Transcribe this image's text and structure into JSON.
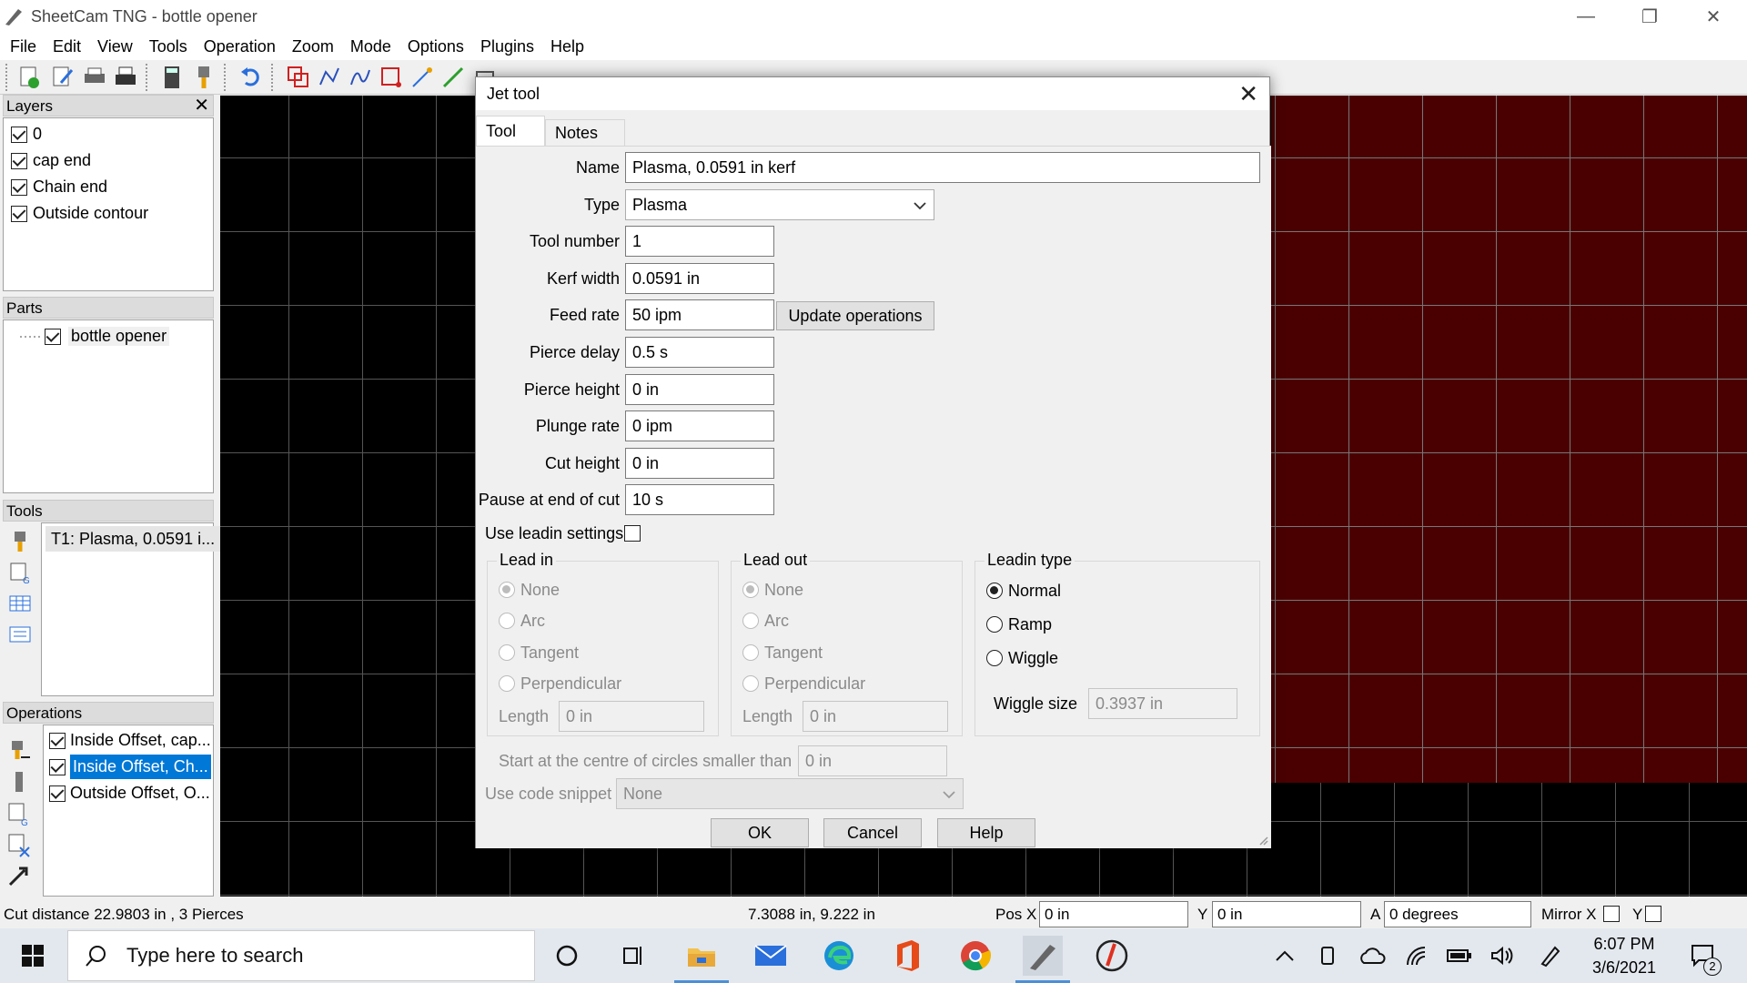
{
  "window": {
    "title": "SheetCam TNG - bottle opener",
    "minimize": "—",
    "restore": "❐",
    "close": "✕"
  },
  "menu": [
    "File",
    "Edit",
    "View",
    "Tools",
    "Operation",
    "Zoom",
    "Mode",
    "Options",
    "Plugins",
    "Help"
  ],
  "layers": {
    "title": "Layers",
    "close": "✕",
    "items": [
      "0",
      "cap end",
      "Chain end",
      "Outside contour"
    ]
  },
  "parts": {
    "title": "Parts",
    "items": [
      "bottle opener"
    ]
  },
  "tools_panel": {
    "title": "Tools",
    "items": [
      "T1: Plasma, 0.0591 i..."
    ]
  },
  "operations": {
    "title": "Operations",
    "items": [
      "Inside Offset, cap...",
      "Inside Offset, Ch...",
      "Outside Offset, O..."
    ]
  },
  "dialog": {
    "title": "Jet tool",
    "close": "✕",
    "tabs": [
      "Tool",
      "Notes"
    ],
    "fields": {
      "name_label": "Name",
      "name_value": "Plasma, 0.0591 in kerf",
      "type_label": "Type",
      "type_value": "Plasma",
      "tool_number_label": "Tool number",
      "tool_number_value": "1",
      "kerf_label": "Kerf width",
      "kerf_value": "0.0591 in",
      "feed_label": "Feed rate",
      "feed_value": "50 ipm",
      "update_button": "Update operations",
      "pierce_delay_label": "Pierce delay",
      "pierce_delay_value": "0.5 s",
      "pierce_height_label": "Pierce height",
      "pierce_height_value": "0 in",
      "plunge_label": "Plunge rate",
      "plunge_value": "0 ipm",
      "cut_height_label": "Cut height",
      "cut_height_value": "0 in",
      "pause_label": "Pause at end of cut",
      "pause_value": "10 s",
      "use_leadin_label": "Use leadin settings"
    },
    "lead_in": {
      "title": "Lead in",
      "options": [
        "None",
        "Arc",
        "Tangent",
        "Perpendicular"
      ],
      "length_label": "Length",
      "length_value": "0 in"
    },
    "lead_out": {
      "title": "Lead out",
      "options": [
        "None",
        "Arc",
        "Tangent",
        "Perpendicular"
      ],
      "length_label": "Length",
      "length_value": "0 in"
    },
    "leadin_type": {
      "title": "Leadin type",
      "options": [
        "Normal",
        "Ramp",
        "Wiggle"
      ],
      "wiggle_label": "Wiggle size",
      "wiggle_value": "0.3937 in"
    },
    "start_centre_label": "Start at the centre of circles smaller than",
    "start_centre_value": "0 in",
    "snippet_label": "Use code snippet",
    "snippet_value": "None",
    "buttons": {
      "ok": "OK",
      "cancel": "Cancel",
      "help": "Help"
    }
  },
  "status": {
    "cut_distance": "Cut distance 22.9803 in , 3 Pierces",
    "coords": "7.3088 in, 9.222 in",
    "pos_x_label": "Pos X",
    "pos_x_value": "0 in",
    "y_label": "Y",
    "y_value": "0 in",
    "a_label": "A",
    "a_value": "0 degrees",
    "mirror_x_label": "Mirror X",
    "mirror_y_label": "Y"
  },
  "taskbar": {
    "search_placeholder": "Type here to search",
    "time": "6:07 PM",
    "date": "3/6/2021",
    "notifications": "2"
  }
}
